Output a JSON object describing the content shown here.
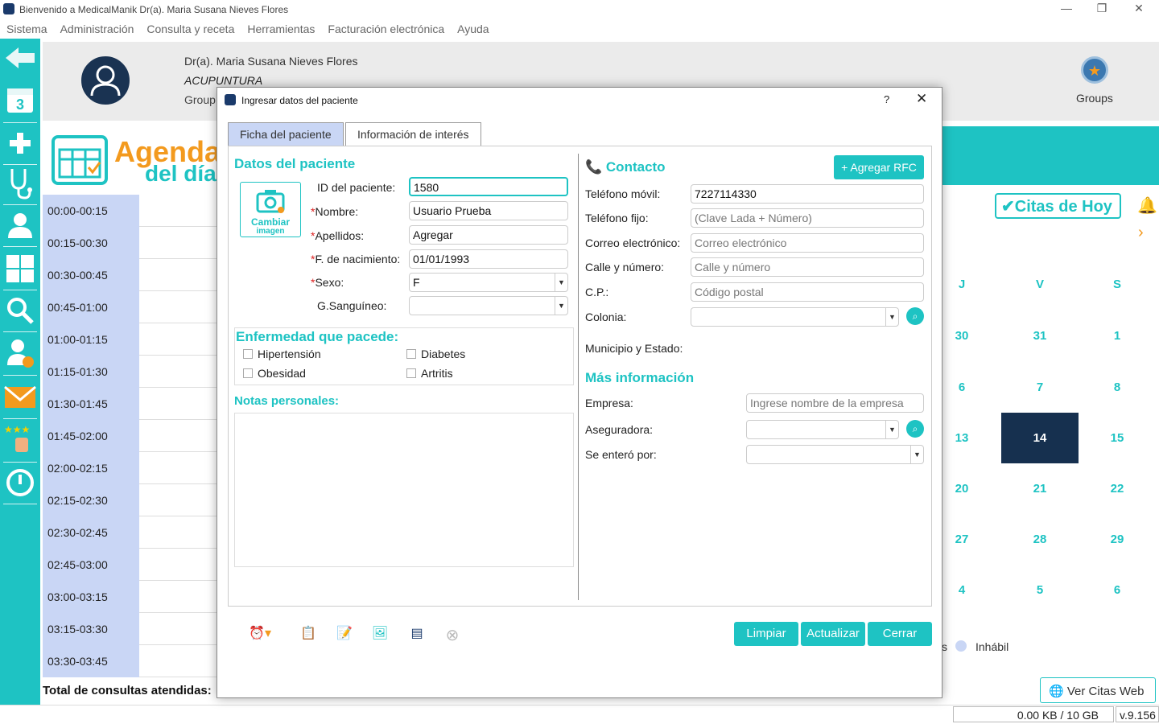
{
  "window": {
    "title": "Bienvenido a MedicalManik Dr(a). Maria Susana Nieves Flores",
    "minimize": "—",
    "restore": "❐",
    "close": "✕"
  },
  "menu": [
    "Sistema",
    "Administración",
    "Consulta y receta",
    "Herramientas",
    "Facturación electrónica",
    "Ayuda"
  ],
  "header": {
    "doctor": "Dr(a). Maria Susana Nieves Flores",
    "specialty": "ACUPUNTURA",
    "group_fragment": "Group",
    "groups_label": "Groups"
  },
  "agenda": {
    "title": "Agenda",
    "subtitle": "del día",
    "slots": [
      "00:00-00:15",
      "00:15-00:30",
      "00:30-00:45",
      "00:45-01:00",
      "01:00-01:15",
      "01:15-01:30",
      "01:30-01:45",
      "01:45-02:00",
      "02:00-02:15",
      "02:15-02:30",
      "02:30-02:45",
      "02:45-03:00",
      "03:00-03:15",
      "03:15-03:30",
      "03:30-03:45"
    ],
    "total_label": "Total de consultas atendidas:"
  },
  "calendar": {
    "citas_hoy": "Citas de Hoy",
    "weekday_headers": [
      "J",
      "V",
      "S"
    ],
    "rows": [
      [
        "30",
        "31",
        "1"
      ],
      [
        "6",
        "7",
        "8"
      ],
      [
        "13",
        "14",
        "15"
      ],
      [
        "20",
        "21",
        "22"
      ],
      [
        "27",
        "28",
        "29"
      ],
      [
        "4",
        "5",
        "6"
      ]
    ],
    "today": "14",
    "legend_fragment": "s",
    "legend_inhabil": "Inhábil",
    "ver_citas_web": "Ver Citas Web"
  },
  "status": {
    "storage": "0.00 KB / 10 GB",
    "version": "v.9.156"
  },
  "dialog": {
    "title": "Ingresar datos del paciente",
    "help": "?",
    "close": "✕",
    "tabs": [
      "Ficha del paciente",
      "Información de interés"
    ],
    "patient": {
      "section": "Datos del paciente",
      "photo_label": "Cambiar",
      "photo_label2": "imagen",
      "id_label": "ID del paciente:",
      "id_value": "1580",
      "name_label": "Nombre:",
      "name_value": "Usuario Prueba",
      "surname_label": "Apellidos:",
      "surname_value": "Agregar",
      "dob_label": "F. de nacimiento:",
      "dob_value": "01/01/1993",
      "sex_label": "Sexo:",
      "sex_value": "F",
      "blood_label": "G.Sanguíneo:",
      "blood_value": "",
      "req_mark": "*"
    },
    "diseases": {
      "section": "Enfermedad que pacede:",
      "items": [
        "Hipertensión",
        "Diabetes",
        "Obesidad",
        "Artritis"
      ]
    },
    "notes": {
      "section": "Notas personales:"
    },
    "contact": {
      "section": "Contacto",
      "add_rfc": "Agregar RFC",
      "mobile_label": "Teléfono móvil:",
      "mobile_value": "7227114330",
      "phone_label": "Teléfono fijo:",
      "phone_placeholder": "(Clave Lada + Número)",
      "email_label": "Correo electrónico:",
      "email_placeholder": "Correo electrónico",
      "street_label": "Calle y número:",
      "street_placeholder": "Calle y número",
      "zip_label": "C.P.:",
      "zip_placeholder": "Código postal",
      "colonia_label": "Colonia:",
      "municipio_label": "Municipio y Estado:"
    },
    "more": {
      "section": "Más información",
      "company_label": "Empresa:",
      "company_placeholder": "Ingrese nombre de la empresa",
      "insurer_label": "Aseguradora:",
      "source_label": "Se enteró por:"
    },
    "buttons": {
      "clear": "Limpiar",
      "update": "Actualizar",
      "close": "Cerrar"
    }
  },
  "colors": {
    "accent": "#1ec3c3",
    "orange": "#f39a1e",
    "navy": "#16304f",
    "slot": "#c9d6f5"
  }
}
